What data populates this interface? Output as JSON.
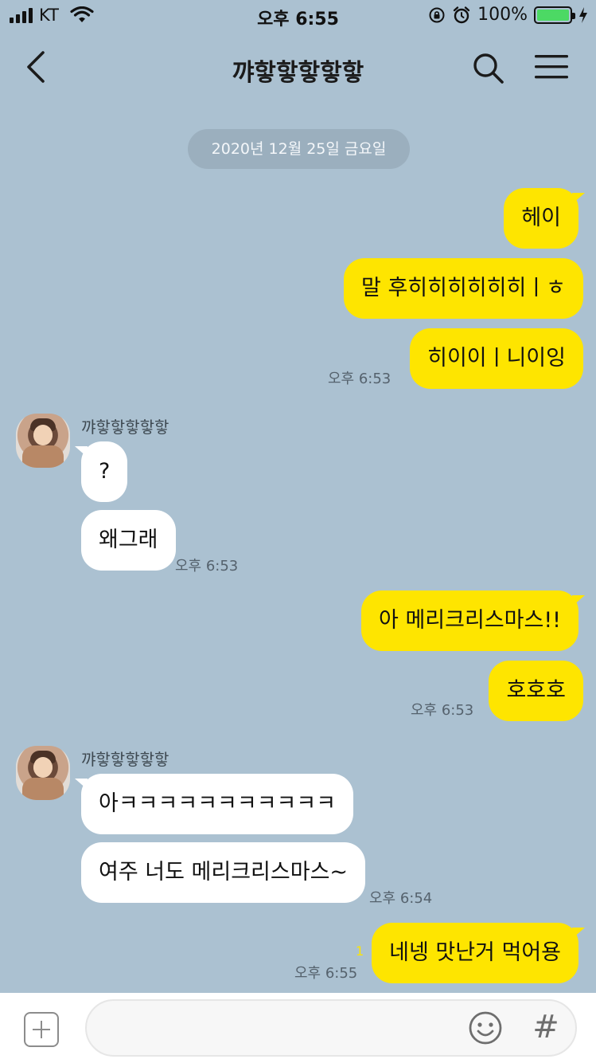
{
  "status_bar": {
    "carrier": "KT",
    "time": "오후 6:55",
    "battery": "100%",
    "battery_level": 1.0,
    "battery_color": "#4cd964"
  },
  "header": {
    "title": "꺄핳핳핳핳핳",
    "back_icon": "chevron-left-icon",
    "search_icon": "search-icon",
    "menu_icon": "hamburger-menu-icon"
  },
  "date_divider": "2020년 12월 25일 금요일",
  "colors": {
    "background": "#abc1d1",
    "my_bubble": "#fee500",
    "their_bubble": "#ffffff"
  },
  "messages": {
    "m1": "헤이",
    "m2": "말 후히히히히히히ㅣㅎ",
    "m3": "히이이ㅣ니이잉",
    "t1": "오후 6:53",
    "sender1": "꺄핳핳핳핳핳",
    "m4": "?",
    "m5": "왜그래",
    "t2": "오후 6:53",
    "m6": "아 메리크리스마스!!",
    "m7": "호호호",
    "t3": "오후 6:53",
    "sender2": "꺄핳핳핳핳핳",
    "m8": "아ㅋㅋㅋㅋㅋㅋㅋㅋㅋㅋㅋ",
    "m9": "여주 너도 메리크리스마스~",
    "t4": "오후 6:54",
    "m10": "네넹 맛난거 먹어용",
    "unread10": "1",
    "t5": "오후 6:55"
  },
  "input_bar": {
    "placeholder": "",
    "plus_icon": "plus-icon",
    "emoji_icon": "emoji-icon",
    "hash_label": "#"
  }
}
